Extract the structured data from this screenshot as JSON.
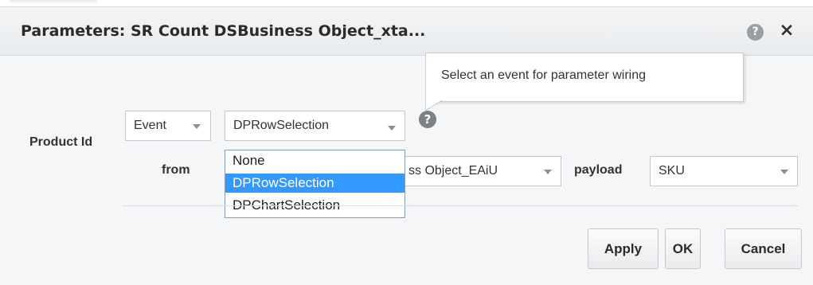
{
  "dialog": {
    "title": "Parameters: SR Count DSBusiness Object_xta...",
    "help_icon": "question-circle-icon",
    "close_icon": "close-icon",
    "close_glyph": "×",
    "help_glyph": "?"
  },
  "tooltip": {
    "text": "Select an event for parameter wiring"
  },
  "form": {
    "param_label": "Product Id",
    "event_type": "Event",
    "event_name": "DPRowSelection",
    "from_label": "from",
    "from_value": "ss Object_EAiU",
    "payload_label": "payload",
    "payload_value": "SKU",
    "inline_help_glyph": "?"
  },
  "dropdown": {
    "options": [
      "None",
      "DPRowSelection",
      "DPChartSelection"
    ],
    "selected_index": 1
  },
  "buttons": {
    "apply": "Apply",
    "ok": "OK",
    "cancel": "Cancel"
  },
  "colors": {
    "selection": "#3399ff",
    "dialog_bg": "#f5f6f7"
  }
}
